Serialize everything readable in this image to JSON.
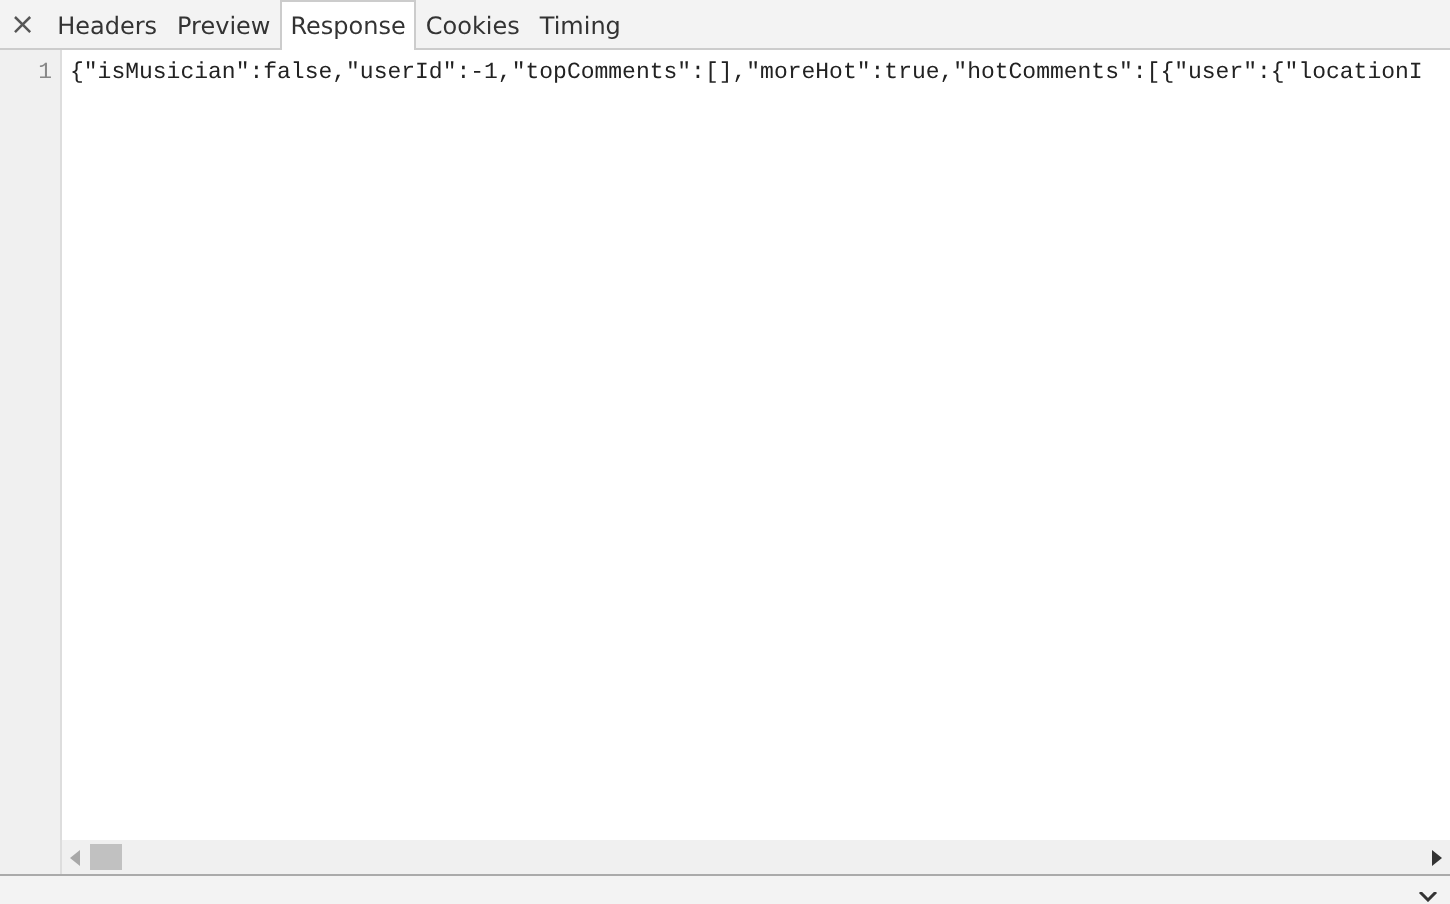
{
  "close_button": "×",
  "tabs": [
    {
      "label": "Headers",
      "selected": false
    },
    {
      "label": "Preview",
      "selected": false
    },
    {
      "label": "Response",
      "selected": true
    },
    {
      "label": "Cookies",
      "selected": false
    },
    {
      "label": "Timing",
      "selected": false
    }
  ],
  "response": {
    "lines": [
      {
        "number": "1",
        "text": "{\"isMusician\":false,\"userId\":-1,\"topComments\":[],\"moreHot\":true,\"hotComments\":[{\"user\":{\"locationI"
      }
    ]
  }
}
